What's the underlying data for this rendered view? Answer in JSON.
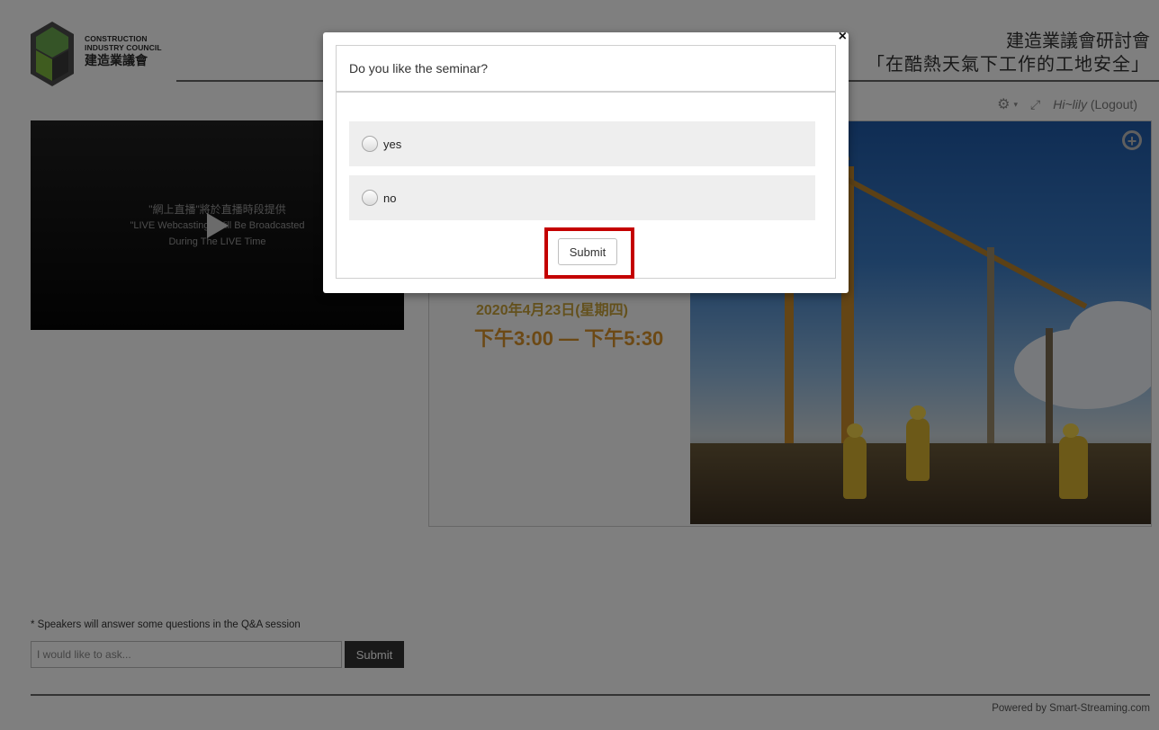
{
  "header": {
    "logo_en_line1": "CONSTRUCTION",
    "logo_en_line2": "INDUSTRY COUNCIL",
    "logo_zh": "建造業議會",
    "title_line1": "建造業議會研討會",
    "title_line2": "「在酷熱天氣下工作的工地安全」",
    "greeting": "Hi~lily",
    "logout_label": "(Logout)"
  },
  "video": {
    "notice_zh": "\"網上直播\"將於直播時段提供",
    "notice_en_line1": "\"LIVE Webcasting\" Will Be Broadcasted",
    "notice_en_line2": "During The LIVE Time"
  },
  "banner": {
    "date": "2020年4月23日(星期四)",
    "time": "下午3:00 — 下午5:30"
  },
  "qa": {
    "note": "* Speakers will answer some questions in the Q&A session",
    "placeholder": "I would like to ask...",
    "submit_label": "Submit"
  },
  "footer": {
    "powered_by": "Powered by Smart-Streaming.com"
  },
  "modal": {
    "close_symbol": "×",
    "question": "Do you like the seminar?",
    "options": [
      {
        "label": "yes"
      },
      {
        "label": "no"
      }
    ],
    "submit_label": "Submit"
  },
  "icons": {
    "gear": "⚙",
    "caret": "▾",
    "expand": "⤢",
    "zoom": "+"
  },
  "colors": {
    "highlight": "#c40000",
    "banner_date": "#c9a23a",
    "banner_time": "#d8922a"
  }
}
